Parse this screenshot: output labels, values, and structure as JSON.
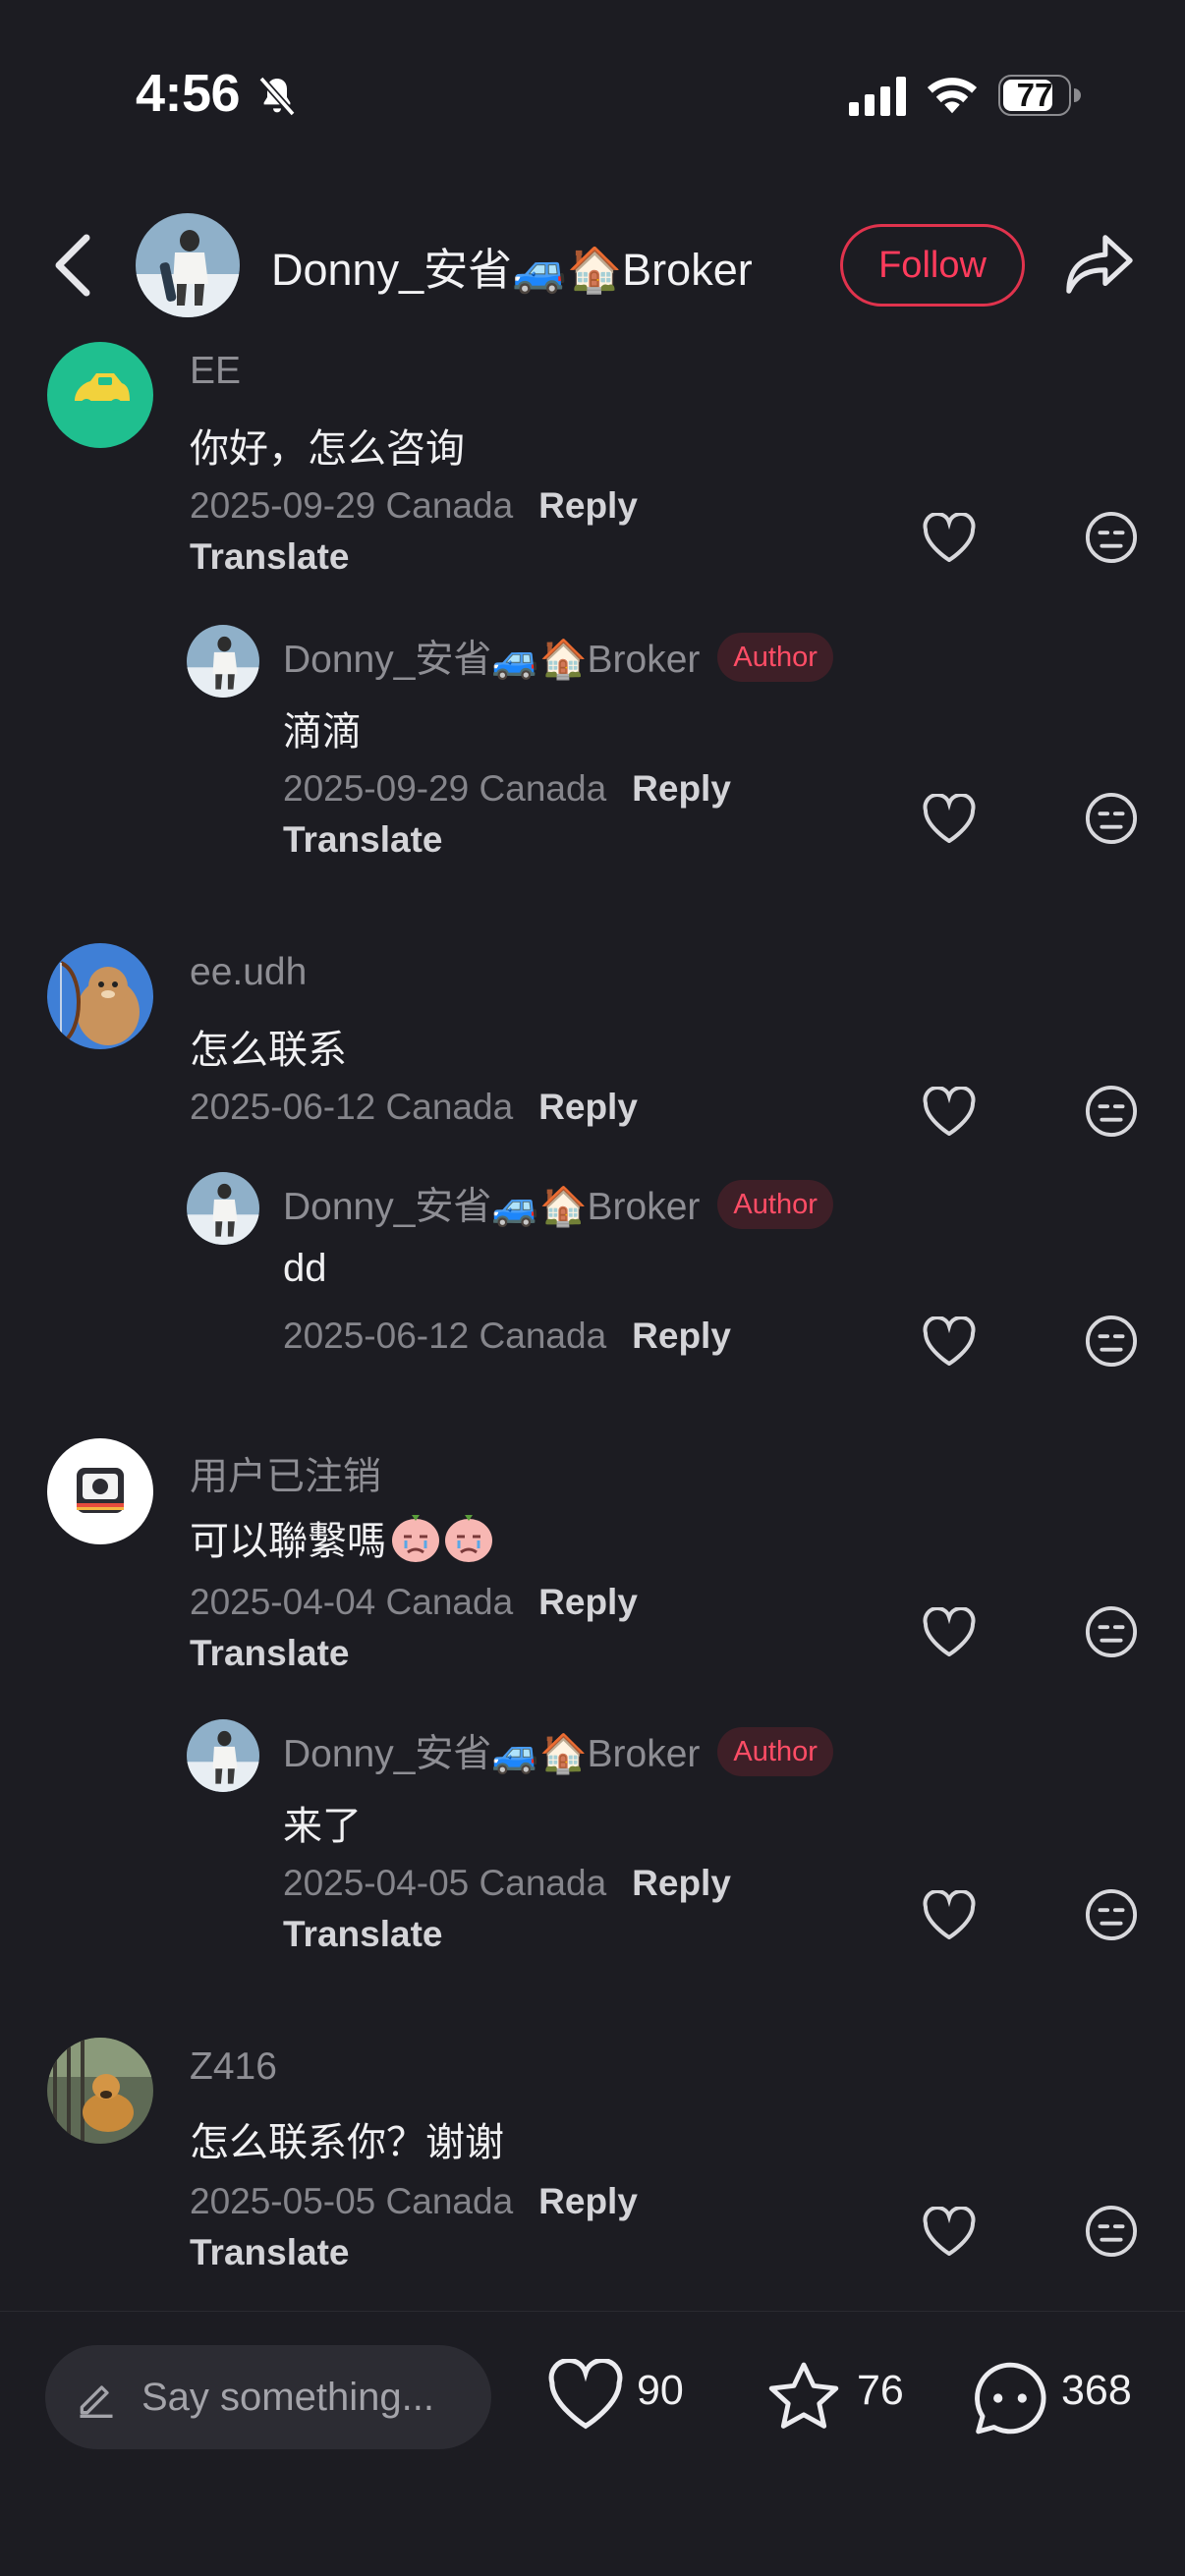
{
  "status_bar": {
    "time": "4:56",
    "battery": "77"
  },
  "header": {
    "author_name": "Donny_安省🚙🏠Broker",
    "follow_label": "Follow"
  },
  "labels": {
    "reply": "Reply",
    "translate": "Translate",
    "author": "Author"
  },
  "comments": [
    {
      "user": "EE",
      "text": "你好，怎么咨询",
      "date_location": "2025-09-29 Canada",
      "reply": {
        "user": "Donny_安省🚙🏠Broker",
        "text": "滴滴",
        "date_location": "2025-09-29 Canada"
      }
    },
    {
      "user": "ee.udh",
      "text": "怎么联系",
      "date_location": "2025-06-12 Canada",
      "reply": {
        "user": "Donny_安省🚙🏠Broker",
        "text": "dd",
        "date_location": "2025-06-12 Canada"
      }
    },
    {
      "user": "用户已注销",
      "text": "可以聯繫嗎",
      "date_location": "2025-04-04 Canada",
      "reply": {
        "user": "Donny_安省🚙🏠Broker",
        "text": "来了",
        "date_location": "2025-04-05 Canada"
      }
    },
    {
      "user": "Z416",
      "text": "怎么联系你？谢谢",
      "date_location": "2025-05-05 Canada"
    }
  ],
  "bottom_bar": {
    "placeholder": "Say something...",
    "likes": "90",
    "favorites": "76",
    "comments": "368"
  },
  "colors": {
    "background": "#1c1c22",
    "accent": "#ff3b5c",
    "muted": "#85858b"
  }
}
